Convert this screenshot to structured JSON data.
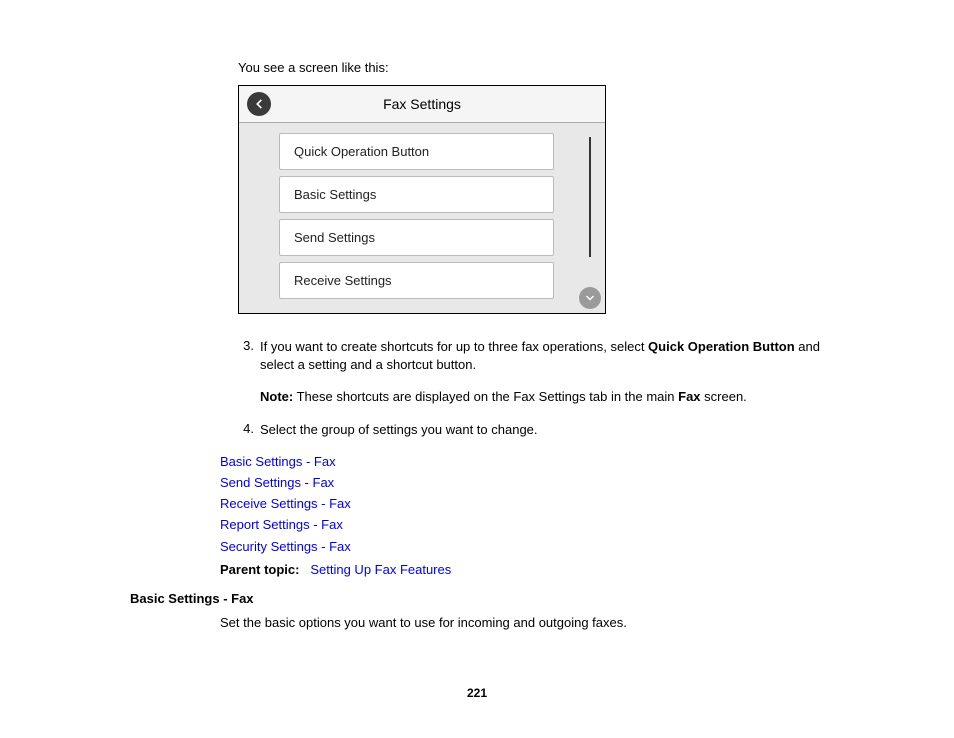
{
  "intro": "You see a screen like this:",
  "screenshot": {
    "title": "Fax Settings",
    "menu_items": [
      "Quick Operation Button",
      "Basic Settings",
      "Send Settings",
      "Receive Settings"
    ]
  },
  "steps": {
    "s3_num": "3.",
    "s3_pre": "If you want to create shortcuts for up to three fax operations, select ",
    "s3_bold": "Quick Operation Button",
    "s3_post": " and select a setting and a shortcut button.",
    "note_label": "Note:",
    "note_pre": " These shortcuts are displayed on the Fax Settings tab in the main ",
    "note_bold": "Fax",
    "note_post": " screen.",
    "s4_num": "4.",
    "s4_text": "Select the group of settings you want to change."
  },
  "links": [
    "Basic Settings - Fax",
    "Send Settings - Fax",
    "Receive Settings - Fax",
    "Report Settings - Fax",
    "Security Settings - Fax"
  ],
  "parent_topic_label": "Parent topic:",
  "parent_topic_link": "Setting Up Fax Features",
  "section_heading": "Basic Settings - Fax",
  "section_body": "Set the basic options you want to use for incoming and outgoing faxes.",
  "page_number": "221"
}
